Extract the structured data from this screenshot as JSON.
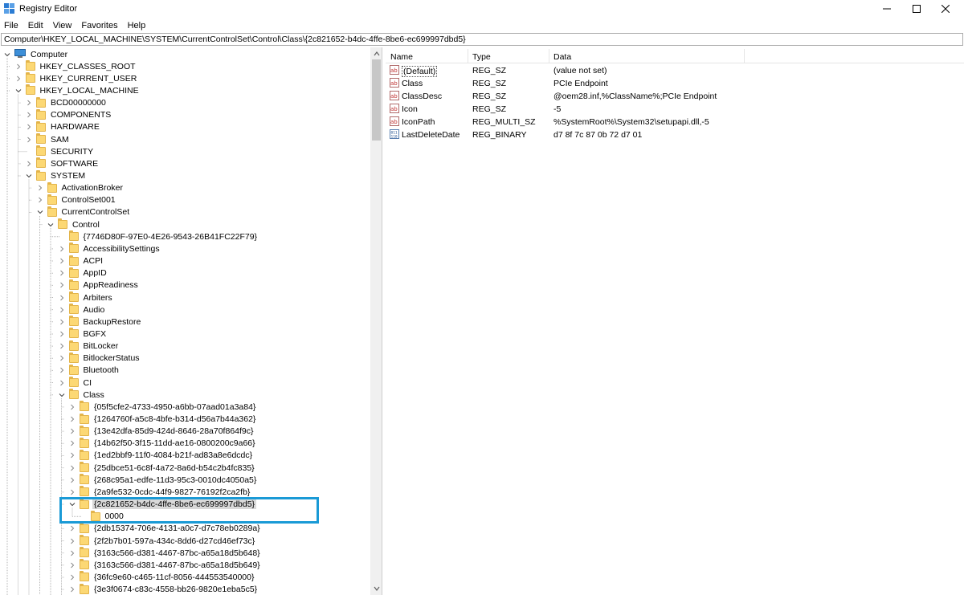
{
  "window": {
    "title": "Registry Editor",
    "icon": "regedit-icon",
    "controls": [
      "minimize-icon",
      "maximize-icon",
      "close-icon"
    ]
  },
  "menu": [
    "File",
    "Edit",
    "View",
    "Favorites",
    "Help"
  ],
  "address": "Computer\\HKEY_LOCAL_MACHINE\\SYSTEM\\CurrentControlSet\\Control\\Class\\{2c821652-b4dc-4ffe-8be6-ec699997dbd5}",
  "tree": [
    {
      "label": "Computer",
      "depth": 0,
      "expander": "open",
      "icon": "computer-icon"
    },
    {
      "label": "HKEY_CLASSES_ROOT",
      "depth": 1,
      "expander": "closed"
    },
    {
      "label": "HKEY_CURRENT_USER",
      "depth": 1,
      "expander": "closed"
    },
    {
      "label": "HKEY_LOCAL_MACHINE",
      "depth": 1,
      "expander": "open"
    },
    {
      "label": "BCD00000000",
      "depth": 2,
      "expander": "closed"
    },
    {
      "label": "COMPONENTS",
      "depth": 2,
      "expander": "closed"
    },
    {
      "label": "HARDWARE",
      "depth": 2,
      "expander": "closed"
    },
    {
      "label": "SAM",
      "depth": 2,
      "expander": "closed"
    },
    {
      "label": "SECURITY",
      "depth": 2,
      "expander": "none"
    },
    {
      "label": "SOFTWARE",
      "depth": 2,
      "expander": "closed"
    },
    {
      "label": "SYSTEM",
      "depth": 2,
      "expander": "open"
    },
    {
      "label": "ActivationBroker",
      "depth": 3,
      "expander": "closed"
    },
    {
      "label": "ControlSet001",
      "depth": 3,
      "expander": "closed"
    },
    {
      "label": "CurrentControlSet",
      "depth": 3,
      "expander": "open"
    },
    {
      "label": "Control",
      "depth": 4,
      "expander": "open"
    },
    {
      "label": "{7746D80F-97E0-4E26-9543-26B41FC22F79}",
      "depth": 5,
      "expander": "none"
    },
    {
      "label": "AccessibilitySettings",
      "depth": 5,
      "expander": "closed"
    },
    {
      "label": "ACPI",
      "depth": 5,
      "expander": "closed"
    },
    {
      "label": "AppID",
      "depth": 5,
      "expander": "closed"
    },
    {
      "label": "AppReadiness",
      "depth": 5,
      "expander": "closed"
    },
    {
      "label": "Arbiters",
      "depth": 5,
      "expander": "closed"
    },
    {
      "label": "Audio",
      "depth": 5,
      "expander": "closed"
    },
    {
      "label": "BackupRestore",
      "depth": 5,
      "expander": "closed"
    },
    {
      "label": "BGFX",
      "depth": 5,
      "expander": "closed"
    },
    {
      "label": "BitLocker",
      "depth": 5,
      "expander": "closed"
    },
    {
      "label": "BitlockerStatus",
      "depth": 5,
      "expander": "closed"
    },
    {
      "label": "Bluetooth",
      "depth": 5,
      "expander": "closed"
    },
    {
      "label": "CI",
      "depth": 5,
      "expander": "closed"
    },
    {
      "label": "Class",
      "depth": 5,
      "expander": "open"
    },
    {
      "label": "{05f5cfe2-4733-4950-a6bb-07aad01a3a84}",
      "depth": 6,
      "expander": "closed"
    },
    {
      "label": "{1264760f-a5c8-4bfe-b314-d56a7b44a362}",
      "depth": 6,
      "expander": "closed"
    },
    {
      "label": "{13e42dfa-85d9-424d-8646-28a70f864f9c}",
      "depth": 6,
      "expander": "closed"
    },
    {
      "label": "{14b62f50-3f15-11dd-ae16-0800200c9a66}",
      "depth": 6,
      "expander": "closed"
    },
    {
      "label": "{1ed2bbf9-11f0-4084-b21f-ad83a8e6dcdc}",
      "depth": 6,
      "expander": "closed"
    },
    {
      "label": "{25dbce51-6c8f-4a72-8a6d-b54c2b4fc835}",
      "depth": 6,
      "expander": "closed"
    },
    {
      "label": "{268c95a1-edfe-11d3-95c3-0010dc4050a5}",
      "depth": 6,
      "expander": "closed"
    },
    {
      "label": "{2a9fe532-0cdc-44f9-9827-76192f2ca2fb}",
      "depth": 6,
      "expander": "closed"
    },
    {
      "label": "{2c821652-b4dc-4ffe-8be6-ec699997dbd5}",
      "depth": 6,
      "expander": "open",
      "selected": true
    },
    {
      "label": "0000",
      "depth": 7,
      "expander": "none"
    },
    {
      "label": "{2db15374-706e-4131-a0c7-d7c78eb0289a}",
      "depth": 6,
      "expander": "closed"
    },
    {
      "label": "{2f2b7b01-597a-434c-8dd6-d27cd46ef73c}",
      "depth": 6,
      "expander": "closed"
    },
    {
      "label": "{3163c566-d381-4467-87bc-a65a18d5b648}",
      "depth": 6,
      "expander": "closed"
    },
    {
      "label": "{3163c566-d381-4467-87bc-a65a18d5b649}",
      "depth": 6,
      "expander": "closed"
    },
    {
      "label": "{36fc9e60-c465-11cf-8056-444553540000}",
      "depth": 6,
      "expander": "closed"
    },
    {
      "label": "{3e3f0674-c83c-4558-bb26-9820e1eba5c5}",
      "depth": 6,
      "expander": "closed"
    }
  ],
  "columns": {
    "name": "Name",
    "type": "Type",
    "data": "Data"
  },
  "values": [
    {
      "name": "(Default)",
      "type": "REG_SZ",
      "data": "(value not set)",
      "icon": "string-value-icon"
    },
    {
      "name": "Class",
      "type": "REG_SZ",
      "data": "PCIe Endpoint",
      "icon": "string-value-icon"
    },
    {
      "name": "ClassDesc",
      "type": "REG_SZ",
      "data": "@oem28.inf,%ClassName%;PCIe Endpoint",
      "icon": "string-value-icon"
    },
    {
      "name": "Icon",
      "type": "REG_SZ",
      "data": "-5",
      "icon": "string-value-icon"
    },
    {
      "name": "IconPath",
      "type": "REG_MULTI_SZ",
      "data": "%SystemRoot%\\System32\\setupapi.dll,-5",
      "icon": "string-value-icon"
    },
    {
      "name": "LastDeleteDate",
      "type": "REG_BINARY",
      "data": "d7 8f 7c 87 0b 72 d7 01",
      "icon": "binary-value-icon"
    }
  ],
  "colors": {
    "highlight": "#1a9ad6",
    "selection": "#d9d9d9",
    "folder": "#fcd874"
  }
}
